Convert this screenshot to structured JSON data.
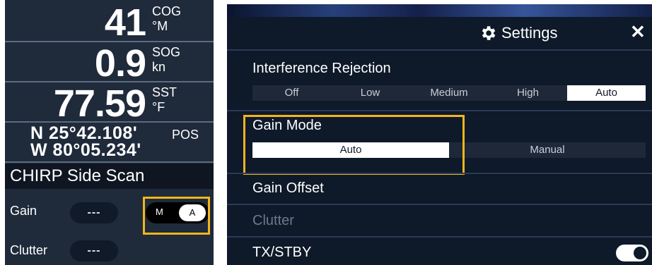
{
  "left_panel": {
    "cog": {
      "value": "41",
      "unit_line1": "COG",
      "unit_line2": "°M"
    },
    "sog": {
      "value": "0.9",
      "unit_line1": "SOG",
      "unit_line2": "kn"
    },
    "sst": {
      "value": "77.59",
      "unit_line1": "SST",
      "unit_line2": "°F"
    },
    "pos": {
      "lat": "N 25°42.108'",
      "lon": "W 80°05.234'",
      "label": "POS"
    },
    "section_title": "CHIRP Side Scan",
    "gain": {
      "label": "Gain",
      "value": "---"
    },
    "clutter": {
      "label": "Clutter",
      "value": "---"
    },
    "mode_toggle": {
      "manual_label": "M",
      "auto_label": "A",
      "selected": "A"
    }
  },
  "settings_panel": {
    "title": "Settings",
    "close_icon": "close-icon",
    "gear_icon": "gear-icon",
    "interference_rejection": {
      "label": "Interference Rejection",
      "options": [
        "Off",
        "Low",
        "Medium",
        "High",
        "Auto"
      ],
      "selected": "Auto"
    },
    "gain_mode": {
      "label": "Gain Mode",
      "options": [
        "Auto",
        "Manual"
      ],
      "selected": "Auto"
    },
    "gain_offset": {
      "label": "Gain Offset"
    },
    "clutter": {
      "label": "Clutter"
    },
    "tx_stby": {
      "label": "TX/STBY",
      "on": true
    }
  },
  "colors": {
    "highlight": "#f2b51c",
    "panel_bg": "#1f2a3b",
    "settings_bg": "#0e1929"
  }
}
